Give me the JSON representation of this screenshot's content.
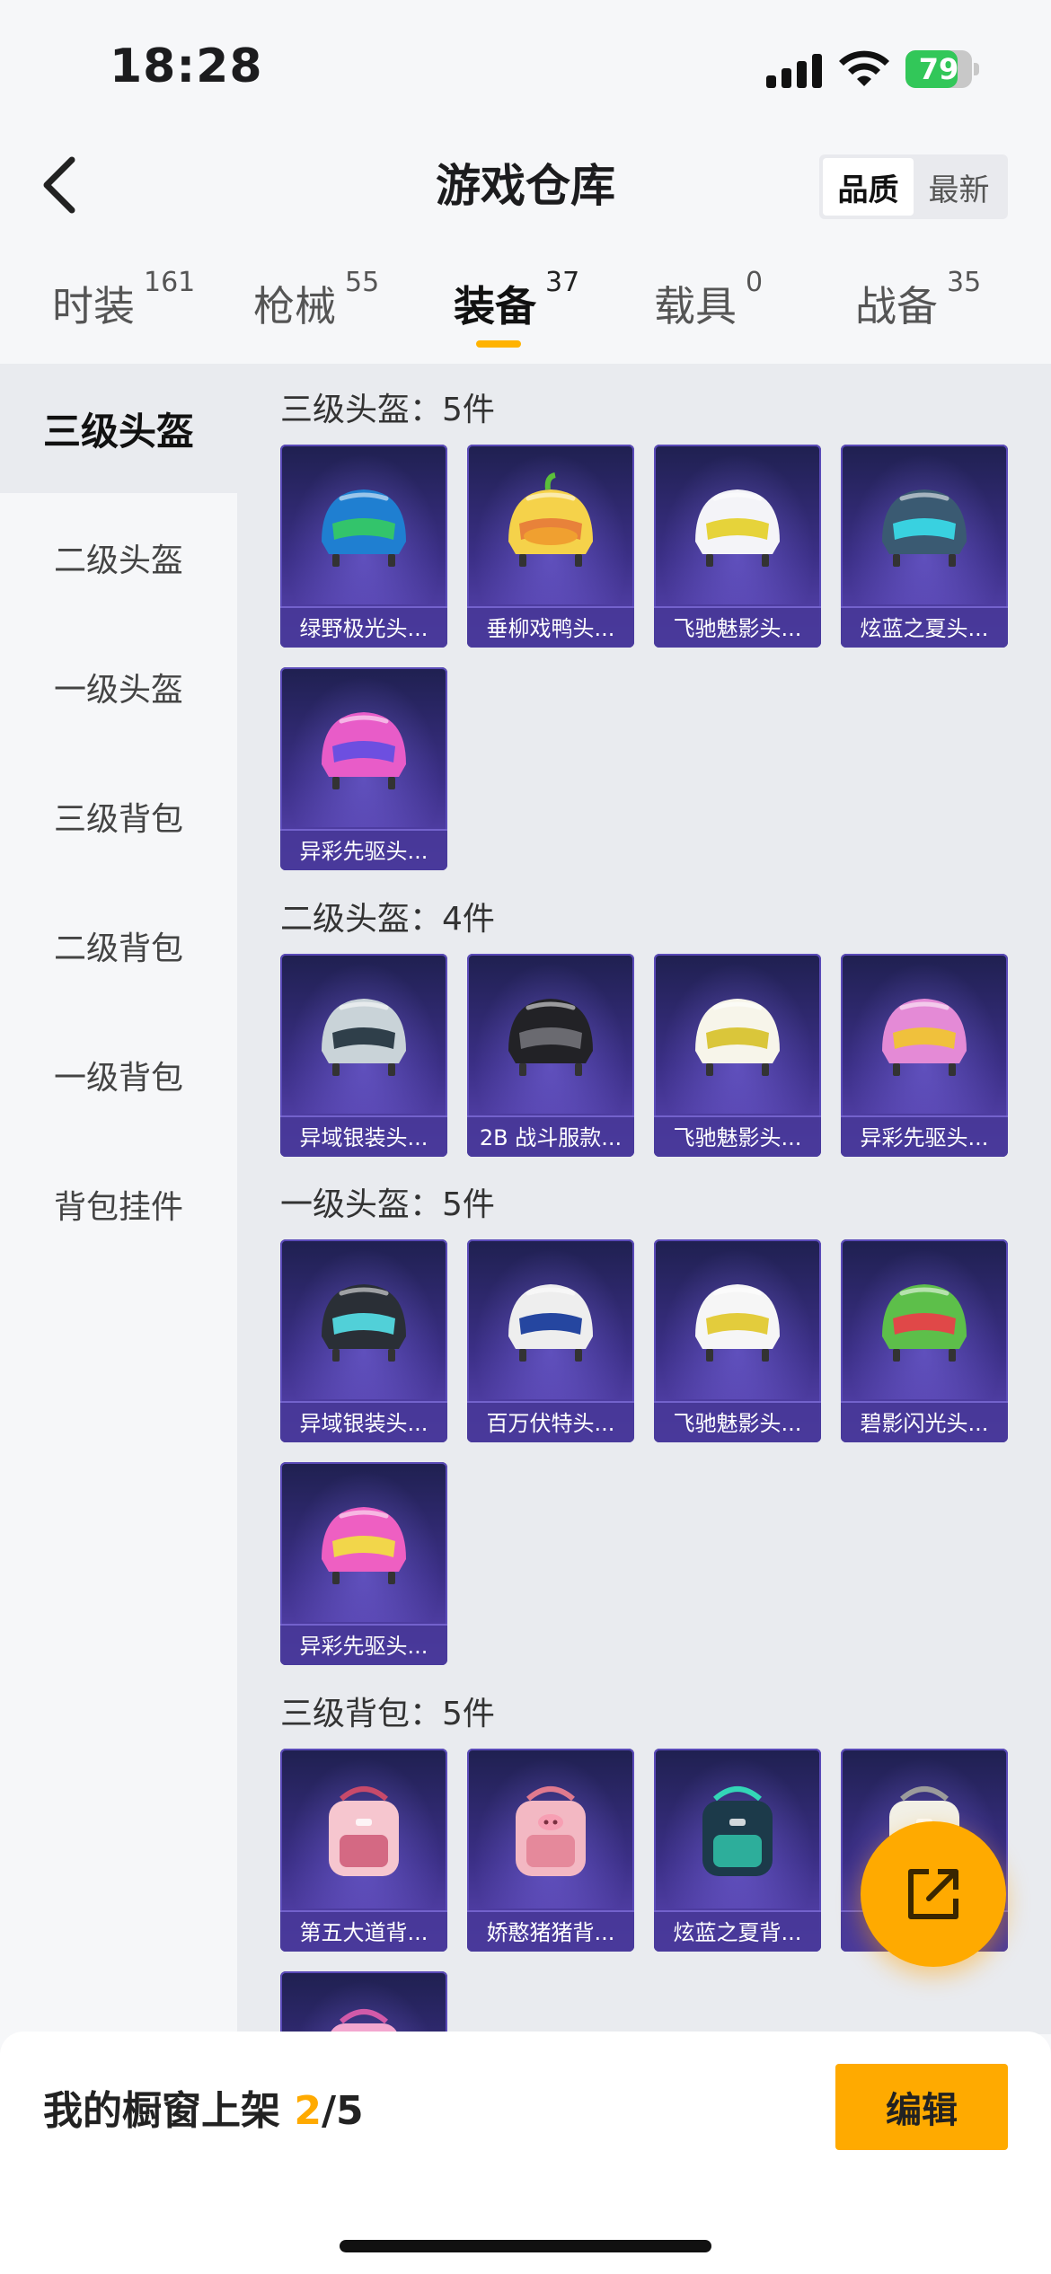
{
  "status_bar": {
    "time": "18:28",
    "battery": "79",
    "battery_level": 0.79
  },
  "nav": {
    "title": "游戏仓库",
    "sort_options": [
      "品质",
      "最新"
    ],
    "sort_active": "品质"
  },
  "tabs": [
    {
      "label": "时装",
      "count": "161",
      "active": false
    },
    {
      "label": "枪械",
      "count": "55",
      "active": false
    },
    {
      "label": "装备",
      "count": "37",
      "active": true
    },
    {
      "label": "载具",
      "count": "0",
      "active": false
    },
    {
      "label": "战备",
      "count": "35",
      "active": false
    }
  ],
  "sidebar": [
    {
      "label": "三级头盔",
      "active": true
    },
    {
      "label": "二级头盔",
      "active": false
    },
    {
      "label": "一级头盔",
      "active": false
    },
    {
      "label": "三级背包",
      "active": false
    },
    {
      "label": "二级背包",
      "active": false
    },
    {
      "label": "一级背包",
      "active": false
    },
    {
      "label": "背包挂件",
      "active": false
    }
  ],
  "sections": [
    {
      "title": "三级头盔：5件",
      "items": [
        {
          "name": "绿野极光头...",
          "icon": "helmet-icon",
          "colors": [
            "#1f7fd1",
            "#33c46b"
          ]
        },
        {
          "name": "垂柳戏鸭头...",
          "icon": "duck-helmet-icon",
          "colors": [
            "#f5d24a",
            "#e8823a"
          ]
        },
        {
          "name": "飞驰魅影头...",
          "icon": "helmet-icon",
          "colors": [
            "#f4f4f8",
            "#e6d33a"
          ]
        },
        {
          "name": "炫蓝之夏头...",
          "icon": "helmet-icon",
          "colors": [
            "#3a5a72",
            "#39d1e0"
          ]
        },
        {
          "name": "异彩先驱头...",
          "icon": "helmet-icon",
          "colors": [
            "#e85cc8",
            "#6d4fe0"
          ]
        }
      ]
    },
    {
      "title": "二级头盔：4件",
      "items": [
        {
          "name": "异域银装头...",
          "icon": "helmet-icon",
          "colors": [
            "#c9d3d8",
            "#2f3f4a"
          ]
        },
        {
          "name": "2B 战斗服款...",
          "icon": "helmet-icon",
          "colors": [
            "#222226",
            "#6a6a70"
          ]
        },
        {
          "name": "飞驰魅影头...",
          "icon": "helmet-icon",
          "colors": [
            "#f7f5ea",
            "#dac63a"
          ]
        },
        {
          "name": "异彩先驱头...",
          "icon": "helmet-icon",
          "colors": [
            "#e48ad6",
            "#f0c13c"
          ]
        }
      ]
    },
    {
      "title": "一级头盔：5件",
      "items": [
        {
          "name": "异域银装头...",
          "icon": "helmet-icon",
          "colors": [
            "#2a2f36",
            "#51d0d8"
          ]
        },
        {
          "name": "百万伏特头...",
          "icon": "helmet-icon",
          "colors": [
            "#eeeeee",
            "#2546a0"
          ]
        },
        {
          "name": "飞驰魅影头...",
          "icon": "helmet-icon",
          "colors": [
            "#f6f6f6",
            "#e3cc3c"
          ]
        },
        {
          "name": "碧影闪光头...",
          "icon": "helmet-icon",
          "colors": [
            "#5dbf4a",
            "#e04848"
          ]
        },
        {
          "name": "异彩先驱头...",
          "icon": "helmet-icon",
          "colors": [
            "#ee5fc2",
            "#f2d64a"
          ]
        }
      ]
    },
    {
      "title": "三级背包：5件",
      "items": [
        {
          "name": "第五大道背...",
          "icon": "backpack-icon",
          "colors": [
            "#f6c6cf",
            "#c84a6a"
          ]
        },
        {
          "name": "娇憨猪猪背...",
          "icon": "pig-backpack-icon",
          "colors": [
            "#f3b8c3",
            "#e07a8e"
          ]
        },
        {
          "name": "炫蓝之夏背...",
          "icon": "backpack-icon",
          "colors": [
            "#1c3a4a",
            "#33d6b7"
          ]
        },
        {
          "name": "",
          "icon": "backpack-icon",
          "colors": [
            "#f2f0e6",
            "#9b9b9b"
          ]
        },
        {
          "name": "",
          "icon": "backpack-icon",
          "colors": [
            "#f3a7cf",
            "#d25aa8"
          ]
        }
      ]
    }
  ],
  "fab": {
    "icon": "share-icon"
  },
  "bottom": {
    "label_prefix": "我的橱窗上架 ",
    "current": "2",
    "label_suffix": "/5",
    "edit_label": "编辑"
  }
}
